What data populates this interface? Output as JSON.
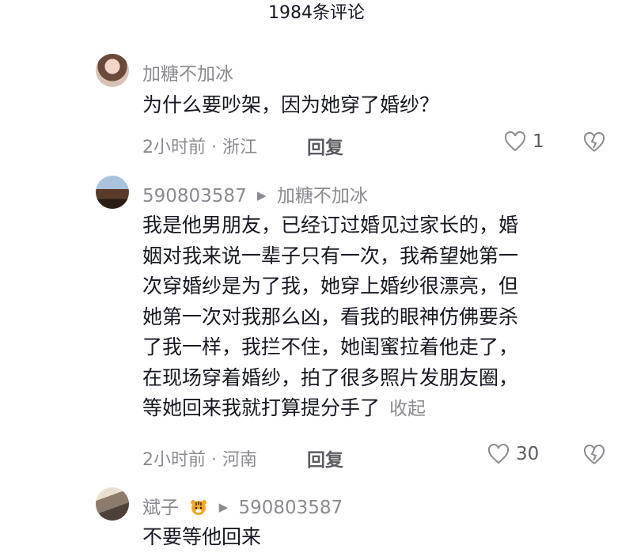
{
  "header": {
    "title": "1984条评论"
  },
  "comments": [
    {
      "username": "加糖不加冰",
      "reply_to": "",
      "lines": [
        "为什么要吵架，因为她穿了婚纱？"
      ],
      "meta": "2小时前 · 浙江",
      "reply_label": "回复",
      "likes": "1",
      "avatar_icon": "avatar-woman"
    },
    {
      "username": "590803587",
      "reply_to": "加糖不加冰",
      "lines": [
        "我是他男朋友，已经订过婚见过家长的，婚",
        "姻对我来说一辈子只有一次，我希望她第一",
        "次穿婚纱是为了我，她穿上婚纱很漂亮，但",
        "她第一次对我那么凶，看我的眼神仿佛要杀",
        "了我一样，我拦不住，她闺蜜拉着他走了，",
        "在现场穿着婚纱，拍了很多照片发朋友圈，",
        "等她回来我就打算提分手了"
      ],
      "collapse_label": "收起",
      "meta": "2小时前 · 河南",
      "reply_label": "回复",
      "likes": "30",
      "avatar_icon": "avatar-building"
    },
    {
      "username": "斌子",
      "badge_icon": "tiger-emoji",
      "reply_to": "590803587",
      "lines": [
        "不要等他回来"
      ],
      "avatar_icon": "avatar-landscape"
    }
  ],
  "icons": {
    "like": "heart-outline-icon",
    "dislike": "broken-heart-icon",
    "reply_arrow": "triangle-right-icon"
  }
}
